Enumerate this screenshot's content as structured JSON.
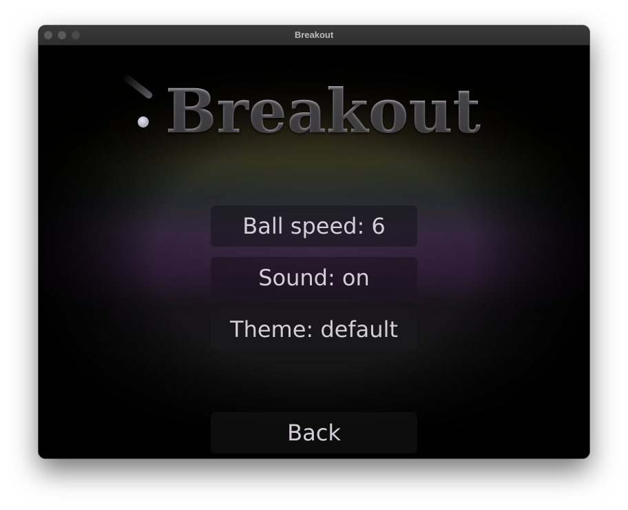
{
  "window": {
    "title": "Breakout"
  },
  "game": {
    "logo_text": "Breakout",
    "menu": {
      "ball_speed_label": "Ball speed: 6",
      "sound_label": "Sound: on",
      "theme_label": "Theme: default",
      "back_label": "Back"
    }
  },
  "icons": {
    "close": "traffic-light-close",
    "minimize": "traffic-light-minimize",
    "zoom": "traffic-light-zoom",
    "ball": "ball-icon"
  }
}
